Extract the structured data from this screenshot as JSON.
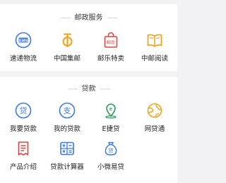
{
  "postal_services": {
    "title": "邮政服务",
    "items": [
      {
        "label": "速递物流",
        "icon": "ems-icon"
      },
      {
        "label": "中国集邮",
        "icon": "philately-icon"
      },
      {
        "label": "邮乐特卖",
        "icon": "shopping-bag-icon"
      },
      {
        "label": "中邮阅读",
        "icon": "open-book-icon"
      }
    ]
  },
  "loans": {
    "title": "贷款",
    "items": [
      {
        "label": "我要贷款",
        "icon": "loan-circle-icon"
      },
      {
        "label": "我的贷款",
        "icon": "payment-circle-icon"
      },
      {
        "label": "E捷贷",
        "icon": "e-location-icon"
      },
      {
        "label": "网贷通",
        "icon": "globe-icon"
      },
      {
        "label": "产品介绍",
        "icon": "document-icon"
      },
      {
        "label": "贷款计算器",
        "icon": "calculator-icon"
      },
      {
        "label": "小微易贷",
        "icon": "money-bag-icon"
      }
    ]
  },
  "colors": {
    "blue": "#3b78e7",
    "orange": "#f4a21c",
    "red": "#e0453f",
    "green": "#2a9d5c"
  }
}
